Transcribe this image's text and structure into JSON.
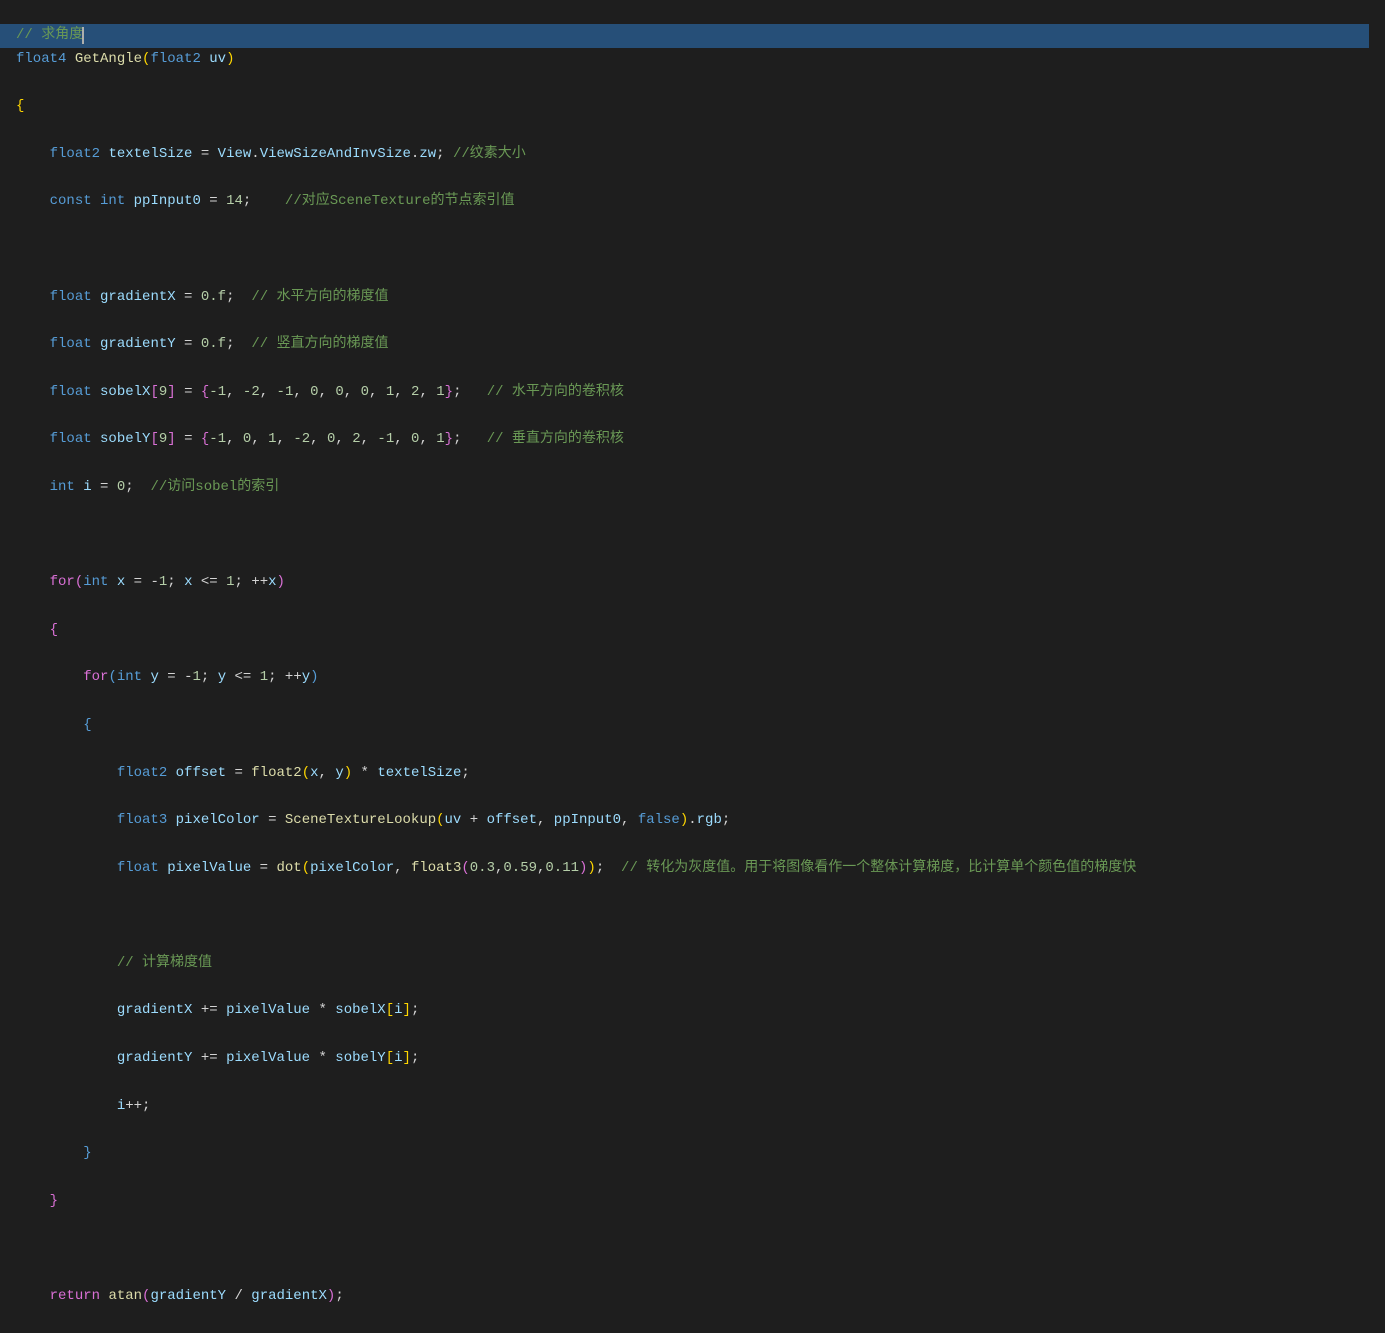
{
  "code": {
    "l1_comment": "// 求角度",
    "l2_a": "float4",
    "l2_b": "GetAngle",
    "l2_c": "(",
    "l2_d": "float2",
    "l2_e": "uv",
    "l2_f": ")",
    "l3_a": "{",
    "l4_a": "float2",
    "l4_b": "textelSize",
    "l4_c": " = ",
    "l4_d": "View",
    "l4_e": ".",
    "l4_f": "ViewSizeAndInvSize",
    "l4_g": ".",
    "l4_h": "zw",
    "l4_i": "; ",
    "l4_j": "//纹素大小",
    "l5_a": "const",
    "l5_b": "int",
    "l5_c": "ppInput0",
    "l5_d": " = ",
    "l5_e": "14",
    "l5_f": ";    ",
    "l5_g": "//对应SceneTexture的节点索引值",
    "l7_a": "float",
    "l7_b": "gradientX",
    "l7_c": " = ",
    "l7_d": "0.f",
    "l7_e": ";  ",
    "l7_f": "// 水平方向的梯度值",
    "l8_a": "float",
    "l8_b": "gradientY",
    "l8_c": " = ",
    "l8_d": "0.f",
    "l8_e": ";  ",
    "l8_f": "// 竖直方向的梯度值",
    "l9_a": "float",
    "l9_b": "sobelX",
    "l9_c": "[",
    "l9_d": "9",
    "l9_e": "]",
    "l9_f": " = ",
    "l9_g": "{",
    "l9_nums": "-1, -2, -1, 0, 0, 0, 1, 2, 1",
    "l9_h": "}",
    "l9_i": ";   ",
    "l9_j": "// 水平方向的卷积核",
    "l10_a": "float",
    "l10_b": "sobelY",
    "l10_c": "[",
    "l10_d": "9",
    "l10_e": "]",
    "l10_f": " = ",
    "l10_g": "{",
    "l10_nums": "-1, 0, 1, -2, 0, 2, -1, 0, 1",
    "l10_h": "}",
    "l10_i": ";   ",
    "l10_j": "// 垂直方向的卷积核",
    "l11_a": "int",
    "l11_b": "i",
    "l11_c": " = ",
    "l11_d": "0",
    "l11_e": ";  ",
    "l11_f": "//访问sobel的索引",
    "l13_a": "for",
    "l13_b": "(",
    "l13_c": "int",
    "l13_d": "x",
    "l13_e": " = -",
    "l13_f": "1",
    "l13_g": "; ",
    "l13_h": "x",
    "l13_i": " <= ",
    "l13_j": "1",
    "l13_k": "; ++",
    "l13_l": "x",
    "l13_m": ")",
    "l14_a": "{",
    "l15_a": "for",
    "l15_b": "(",
    "l15_c": "int",
    "l15_d": "y",
    "l15_e": " = -",
    "l15_f": "1",
    "l15_g": "; ",
    "l15_h": "y",
    "l15_i": " <= ",
    "l15_j": "1",
    "l15_k": "; ++",
    "l15_l": "y",
    "l15_m": ")",
    "l16_a": "{",
    "l17_a": "float2",
    "l17_b": "offset",
    "l17_c": " = ",
    "l17_d": "float2",
    "l17_e": "(",
    "l17_f": "x",
    "l17_g": ", ",
    "l17_h": "y",
    "l17_i": ")",
    "l17_j": " * ",
    "l17_k": "textelSize",
    "l17_l": ";",
    "l18_a": "float3",
    "l18_b": "pixelColor",
    "l18_c": " = ",
    "l18_d": "SceneTextureLookup",
    "l18_e": "(",
    "l18_f": "uv",
    "l18_g": " + ",
    "l18_h": "offset",
    "l18_i": ", ",
    "l18_j": "ppInput0",
    "l18_k": ", ",
    "l18_l": "false",
    "l18_m": ")",
    "l18_n": ".",
    "l18_o": "rgb",
    "l18_p": ";",
    "l19_a": "float",
    "l19_b": "pixelValue",
    "l19_c": " = ",
    "l19_d": "dot",
    "l19_e": "(",
    "l19_f": "pixelColor",
    "l19_g": ", ",
    "l19_h": "float3",
    "l19_i": "(",
    "l19_j": "0.3",
    "l19_k": ",",
    "l19_l": "0.59",
    "l19_m": ",",
    "l19_n": "0.11",
    "l19_o": ")",
    "l19_p": ")",
    "l19_q": ";  ",
    "l19_r": "// 转化为灰度值。用于将图像看作一个整体计算梯度，比计算单个颜色值的梯度快",
    "l21_a": "// 计算梯度值",
    "l22_a": "gradientX",
    "l22_b": " += ",
    "l22_c": "pixelValue",
    "l22_d": " * ",
    "l22_e": "sobelX",
    "l22_f": "[",
    "l22_g": "i",
    "l22_h": "]",
    "l22_i": ";",
    "l23_a": "gradientY",
    "l23_b": " += ",
    "l23_c": "pixelValue",
    "l23_d": " * ",
    "l23_e": "sobelY",
    "l23_f": "[",
    "l23_g": "i",
    "l23_h": "]",
    "l23_i": ";",
    "l24_a": "i",
    "l24_b": "++;",
    "l25_a": "}",
    "l26_a": "}",
    "l28_a": "return",
    "l28_b": "atan",
    "l28_c": "(",
    "l28_d": "gradientY",
    "l28_e": " / ",
    "l28_f": "gradientX",
    "l28_g": ")",
    "l28_h": ";"
  }
}
